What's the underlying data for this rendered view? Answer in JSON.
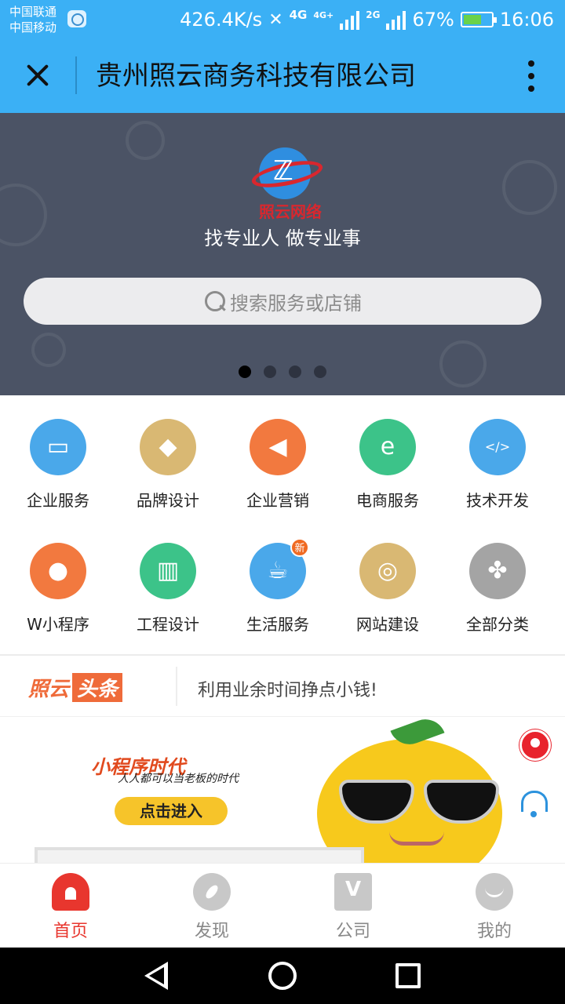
{
  "status_bar": {
    "carrier_1": "中国联通",
    "carrier_2": "中国移动",
    "network_speed": "426.4K/s",
    "network_1": "4G",
    "network_1_plus": "4G+",
    "network_2": "2G",
    "battery_percent": "67%",
    "battery_level": 0.67,
    "time": "16:06"
  },
  "title_bar": {
    "title": "贵州照云商务科技有限公司"
  },
  "banner": {
    "logo_text": "照云网络",
    "slogan": "找专业人 做专业事",
    "search_placeholder": "搜索服务或店铺",
    "carousel_pages": 4,
    "carousel_active_index": 0
  },
  "categories": [
    {
      "label": "企业服务",
      "icon": "briefcase-icon",
      "color": "#4aa8ea"
    },
    {
      "label": "品牌设计",
      "icon": "tag-icon",
      "color": "#d9b873"
    },
    {
      "label": "企业营销",
      "icon": "megaphone-icon",
      "color": "#f2793f"
    },
    {
      "label": "电商服务",
      "icon": "shopping-bag-icon",
      "color": "#3cc389"
    },
    {
      "label": "技术开发",
      "icon": "code-window-icon",
      "color": "#4aa8ea"
    },
    {
      "label": "W小程序",
      "icon": "lightbulb-icon",
      "color": "#f2793f"
    },
    {
      "label": "工程设计",
      "icon": "building-icon",
      "color": "#3cc389"
    },
    {
      "label": "生活服务",
      "icon": "coffee-cup-icon",
      "color": "#4aa8ea",
      "badge": "新"
    },
    {
      "label": "网站建设",
      "icon": "globe-icon",
      "color": "#d9b873"
    },
    {
      "label": "全部分类",
      "icon": "grid-petals-icon",
      "color": "#a4a4a4"
    }
  ],
  "headline": {
    "brand": "照云",
    "brand_tag": "头条",
    "text": "利用业余时间挣点小钱!"
  },
  "promo": {
    "title": "小程序时代",
    "subtitle": "人人都可以当老板的时代",
    "button": "点击进入"
  },
  "tabs": [
    {
      "label": "首页",
      "icon": "home-icon",
      "active": true
    },
    {
      "label": "发现",
      "icon": "discover-icon",
      "active": false
    },
    {
      "label": "公司",
      "icon": "company-icon",
      "active": false
    },
    {
      "label": "我的",
      "icon": "profile-icon",
      "active": false
    }
  ],
  "colors": {
    "primary": "#3bb0f5",
    "active_tab": "#e8362e",
    "banner_bg": "#4b5365"
  }
}
